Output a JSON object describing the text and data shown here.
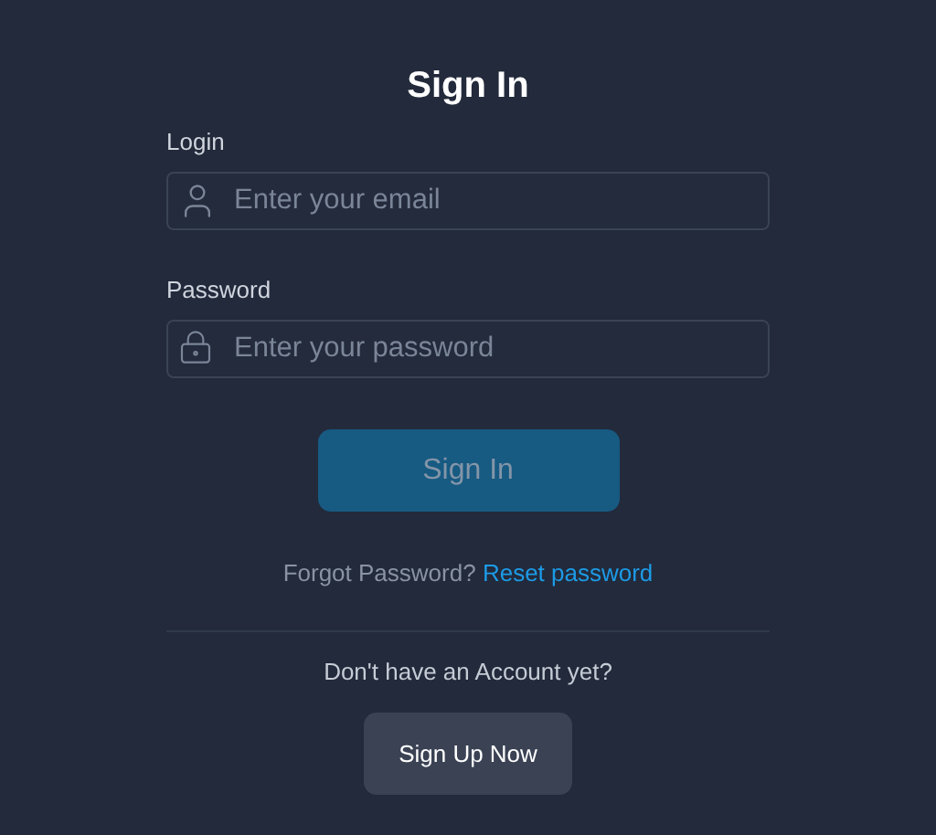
{
  "title": "Sign In",
  "fields": [
    {
      "label": "Login",
      "placeholder": "Enter your email",
      "kind": "email"
    },
    {
      "label": "Password",
      "placeholder": "Enter your password",
      "kind": "password"
    }
  ],
  "submit": {
    "label": "Sign In",
    "disabled": true
  },
  "forgot": {
    "text": "Forgot Password?",
    "link": "Reset password"
  },
  "signup": {
    "prompt": "Don't have an Account yet?",
    "button": "Sign Up Now"
  }
}
